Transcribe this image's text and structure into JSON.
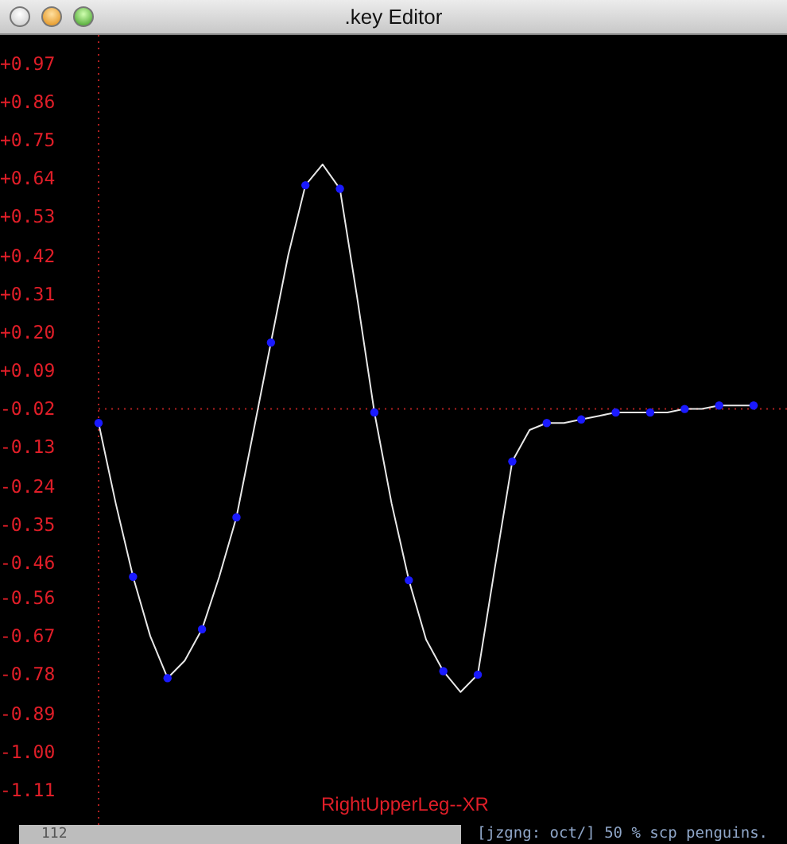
{
  "window": {
    "title": ".key Editor"
  },
  "editor": {
    "chart_data": {
      "type": "line",
      "categories": [
        null,
        null,
        null,
        null,
        null,
        null,
        null,
        null,
        null,
        null,
        null,
        null,
        null,
        null,
        null,
        null,
        null,
        null,
        null,
        null,
        null,
        null,
        null,
        null,
        null,
        null,
        null,
        null,
        null,
        null,
        null,
        null,
        null,
        null,
        null,
        null,
        null,
        null,
        null
      ],
      "ylim": [
        -1.21,
        1.05
      ],
      "ref_lines": [
        {
          "value": -0.02,
          "axis": "y",
          "color": "#b02020"
        }
      ],
      "yticks": [
        {
          "value": 0.97,
          "label": "+0.97"
        },
        {
          "value": 0.86,
          "label": "+0.86"
        },
        {
          "value": 0.75,
          "label": "+0.75"
        },
        {
          "value": 0.64,
          "label": "+0.64"
        },
        {
          "value": 0.53,
          "label": "+0.53"
        },
        {
          "value": 0.42,
          "label": "+0.42"
        },
        {
          "value": 0.31,
          "label": "+0.31"
        },
        {
          "value": 0.2,
          "label": "+0.20"
        },
        {
          "value": 0.09,
          "label": "+0.09"
        },
        {
          "value": -0.02,
          "label": "-0.02"
        },
        {
          "value": -0.13,
          "label": "-0.13"
        },
        {
          "value": -0.24,
          "label": "-0.24"
        },
        {
          "value": -0.35,
          "label": "-0.35"
        },
        {
          "value": -0.46,
          "label": "-0.46"
        },
        {
          "value": -0.56,
          "label": "-0.56"
        },
        {
          "value": -0.67,
          "label": "-0.67"
        },
        {
          "value": -0.78,
          "label": "-0.78"
        },
        {
          "value": -0.89,
          "label": "-0.89"
        },
        {
          "value": -1.0,
          "label": "-1.00"
        },
        {
          "value": -1.11,
          "label": "-1.11"
        }
      ],
      "series": [
        {
          "color": "#e8e8e8",
          "values": [
            -0.06,
            -0.29,
            -0.5,
            -0.67,
            -0.79,
            -0.74,
            -0.65,
            -0.5,
            -0.33,
            -0.08,
            0.17,
            0.42,
            0.62,
            0.68,
            0.61,
            0.3,
            -0.03,
            -0.29,
            -0.51,
            -0.68,
            -0.77,
            -0.83,
            -0.78,
            -0.47,
            -0.17,
            -0.08,
            -0.06,
            -0.06,
            -0.05,
            -0.04,
            -0.03,
            -0.03,
            -0.03,
            -0.03,
            -0.02,
            -0.02,
            -0.01,
            -0.01,
            -0.01
          ]
        }
      ]
    },
    "curve_label": "RightUpperLeg--XR"
  },
  "background_window": {
    "line_number": "112",
    "terminal_text": "[jzgng: oct/] 50 % scp penguins."
  }
}
